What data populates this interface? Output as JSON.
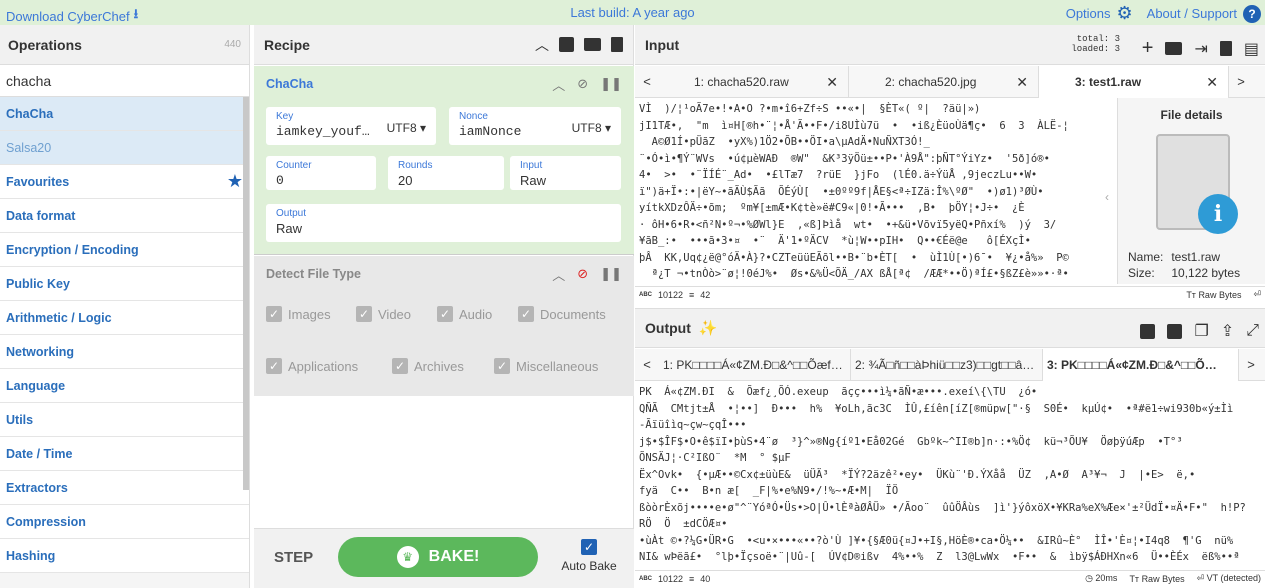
{
  "banner": {
    "download": "Download CyberChef",
    "last_build": "Last build: A year ago",
    "options": "Options",
    "about": "About / Support"
  },
  "operations": {
    "title": "Operations",
    "count": "440",
    "search_value": "chacha",
    "results": [
      "ChaCha",
      "Salsa20"
    ],
    "categories": [
      "Favourites",
      "Data format",
      "Encryption / Encoding",
      "Public Key",
      "Arithmetic / Logic",
      "Networking",
      "Language",
      "Utils",
      "Date / Time",
      "Extractors",
      "Compression",
      "Hashing"
    ]
  },
  "recipe": {
    "title": "Recipe",
    "chacha": {
      "name": "ChaCha",
      "key_label": "Key",
      "key_value": "iamkey_youf…",
      "key_format": "UTF8",
      "nonce_label": "Nonce",
      "nonce_value": "iamNonce",
      "nonce_format": "UTF8",
      "counter_label": "Counter",
      "counter_value": "0",
      "rounds_label": "Rounds",
      "rounds_value": "20",
      "input_label": "Input",
      "input_value": "Raw",
      "output_label": "Output",
      "output_value": "Raw"
    },
    "detect": {
      "name": "Detect File Type",
      "options": [
        "Images",
        "Video",
        "Audio",
        "Documents",
        "Applications",
        "Archives",
        "Miscellaneous"
      ]
    },
    "step": "STEP",
    "bake": "BAKE!",
    "autobake": "Auto Bake"
  },
  "input": {
    "title": "Input",
    "stats_total": "total:  3",
    "stats_loaded": "loaded:  3",
    "tabs": [
      "1: chacha520.raw",
      "2: chacha520.jpg",
      "3: test1.raw"
    ],
    "text_lines": [
      "VÌ  )/¦¹oÃ7e•!•A•O ?•m•î6+Zf÷S ••«•|  §ÈT«( º|  ?äü|»)  ",
      "jI1TÆ•,  \"m  ì¤H[®h•¨¦•Å'Ã••F•/i8UÌù7ü  •  •iß¿ÈüoÙä¶ç•  6  3  ÀLË-¦",
      "  A©Ø1Í•pÜãZ  •yX%)1Ö2•ÕB••ÖI•a\\µAdÄ•NuÑXT3Ó!_",
      "¨•Ó•ì•¶Ý¨WVs  •ú¢µèWAÐ  ®W\"  &K³3ÿÖü±••P•'À9Å\":þÑT°ÝiYz•  '5ð]ó®•",
      "4•  >•  •¨ÏÍÉ¨_Ad•  •£lTæ7  ?rüE  }jFo  (lÉ0.ä÷ÝüÅ ,9jeczLu••W•",
      "ï\")ä+Ï•:•|ëY~•ãÃÙ$Ãã  ÕÉýÙ[  •±0ºº9f|ÅE§<ª÷IZä:Î%\\ºØ\"  •)ø1)³ØÙ•",
      "yítkXDzÔÄ÷•õm;  ºm¥[±mÆ•K¢tè»ë#C9«|0!•Ã•••  ,B•  þÖY¦•J÷•  ¿È",
      "· ôH•6•R•<ñ²N•º¬•%ØWl}E  ,«ß]Þìå  wt•  •+&ü•Võvï5yëQ•Pñxí%  )ý  3/",
      "¥ãB_:•  •••ã•3•¤  •¨  Ä'1•ºÄCV  *ù¦W••pIH•  Q••€Éë@e   ô[ÉXçÌ•  ",
      "þÂ  KK,Uq¢¿ë@°óÄ•À}?•CZTeüüEÃõl••B•¨b•ÈT[  •  ùÌ1Ù[•)6¯•  ¥¿•å%»  P©",
      "  ª¿T ¬•tnÒò>¨ø¦!0éJ%•  Øs•&%Ü<ÕÄ_/AX ßÅ[ª¢  /ÆÆ*••Ö)ªÍ£•§ßZ£è»»•·ª•"
    ],
    "status_chars": "10122",
    "status_lines": "42",
    "status_right": "Raw Bytes",
    "file_details": {
      "title": "File details",
      "name_label": "Name:",
      "name_value": "test1.raw",
      "size_label": "Size:",
      "size_value": "10,122 bytes"
    }
  },
  "output": {
    "title": "Output",
    "tabs": [
      "1: PK□□□□Á«¢ZM.Ð□&^□□Õæf…",
      "2: ¾Ã□ñ□□àÞhiü□□z3)□□gt□□â…",
      "3: PK□□□□Á«¢ZM.Ð□&^□□Õ…"
    ],
    "text_lines": [
      "PK  Á«¢ZM.ÐI  &  Õæf¿¸ÕÓ.exeup  ãçç•••ì¼•ãÑ•æ•••.exeí\\{\\TU  ¿ó•",
      "QÑÃ  CMtjt±Å  •¦••]  Ð•••  h%  ¥oLh,ãc3C  ÌÛ,£íên[íZ[®müpw[\"·§  S0É•  kµÚ¢•  •ª#ë1÷wi930b«ý±Ìì",
      "-Ãïüîìq~çw~çqÎ•••",
      "j$•$ÎF$•O•ê$ïI•þùS•4¨ø  ³}^»®Ng{íº1•Eå02Gé  Gbºk~^II®b]n·:•%Ö¢  kü¬³ÕU¥  ÖøþÿúÆp  •T°³",
      "ÕNSÄJ¦·C²IßO¨  *M  ° $µF",
      "Ëx^Ovk•  {•µÆ••©Cx¢±üùE&  üÜÄ³  *ÏÝ?2äzê²•ey•  ÜKù¨'Ð.ÝXåå  ÜZ  ,A•Ø  A³¥¬  J  |•E>  ë,•",
      "fyä  C••  B•n æ[  _F|%•e%N9•/!%~•Æ•M|  ÏÖ",
      "ßòòrÈxõj••••e•ø\"^¨YóªÓ•Üs•>O|Û•lÈªàØÂÜ» •/Ãoo¨  ûûÖÂùs  ]ì'}ýôxöX•¥KRa%eX%Æe×'±²ÜdÏ•¤Ä•F•\"  h!P?",
      "RÖ  Ö  ±dCÖÆ¤•",
      "•ùÀt ©•?¼G•ÜR•G  •<u•×•••«••?ò'Ù ]¥•{§Æ0ü{¤J•+I§,HöÈ®•ca•Ö¼••  &IRû~È°  ÌÎ•'È¤¦•I4q8  ¶'G  nü%",
      "NI& wÞëã£•  °lþ•Ïçsoë•¨|Uû-[  ÚV¢D®ißv  4%••%  Z  l3@LwWx  •F••  &  ìbÿ$ÁÐHXn«6  Ü••ÈÉx  ëß%••ª"
    ],
    "status_chars": "10122",
    "status_lines": "40",
    "status_time": "20ms",
    "status_raw": "Raw Bytes",
    "status_detected": "VT (detected)"
  }
}
